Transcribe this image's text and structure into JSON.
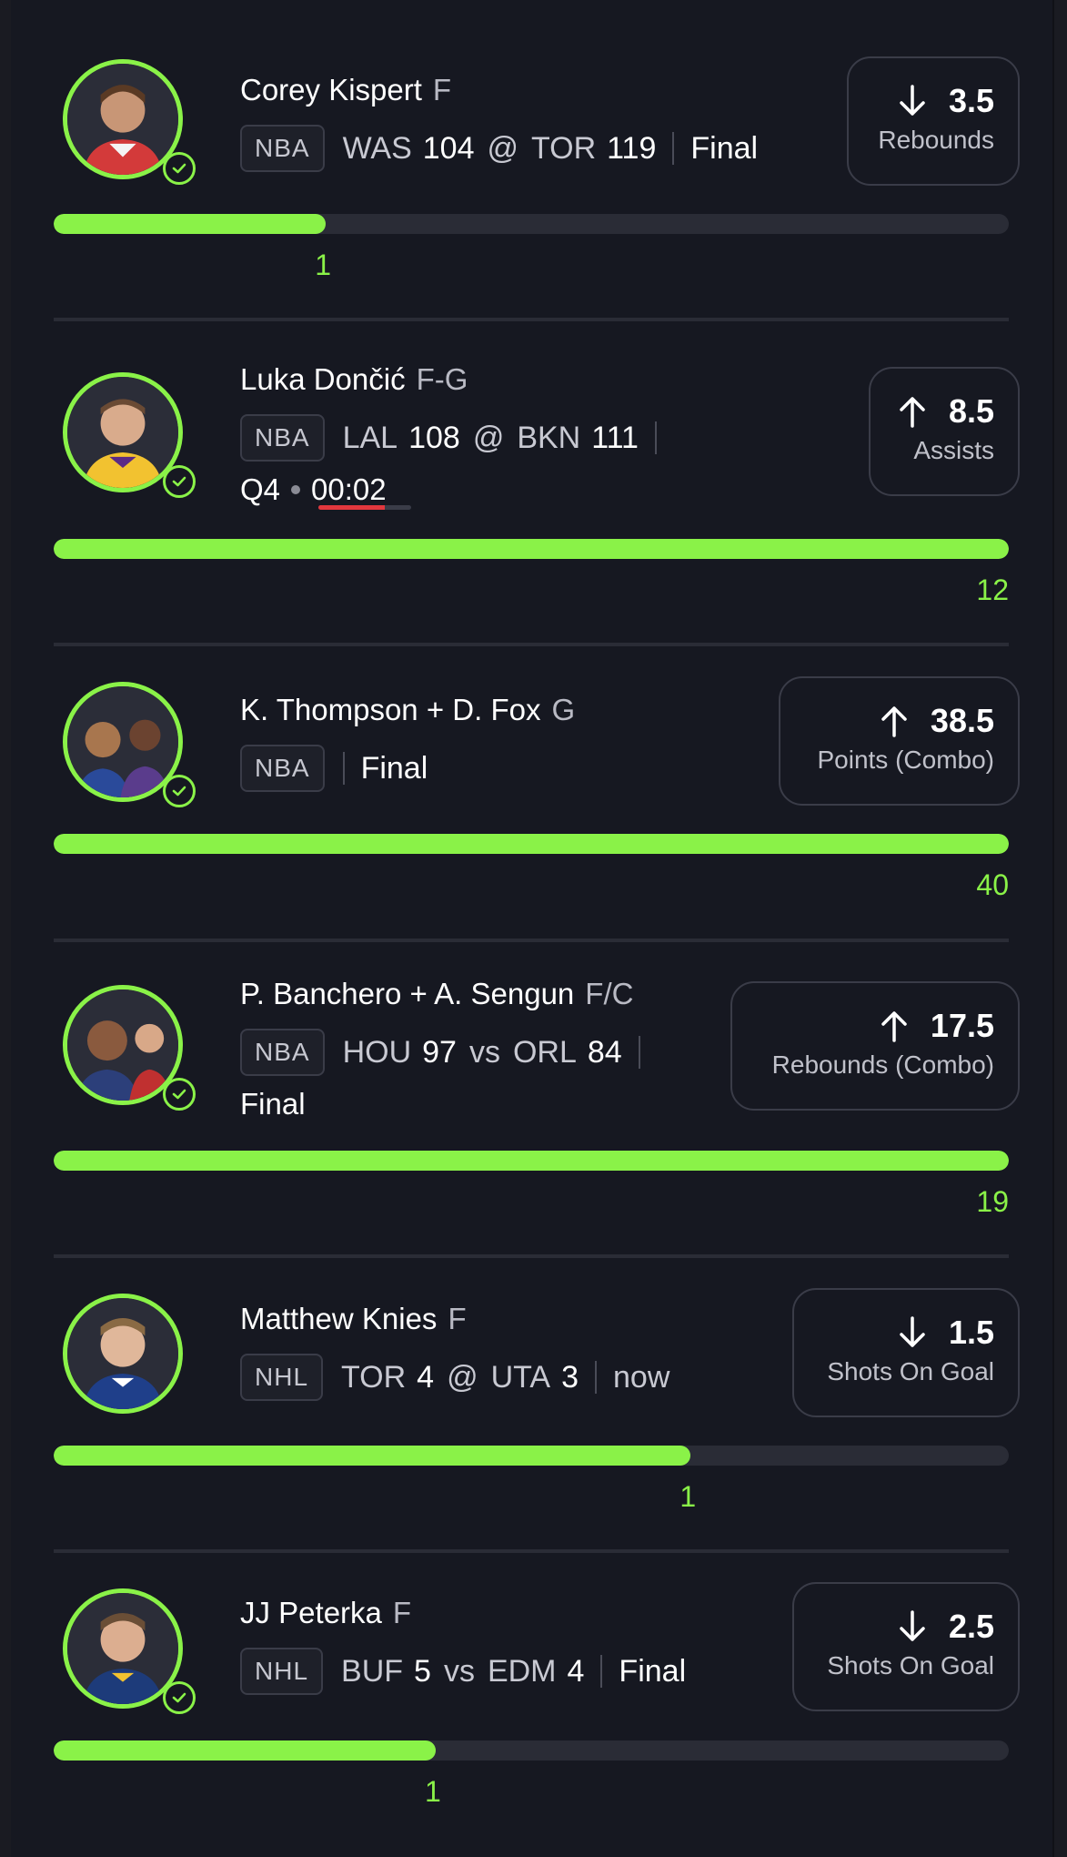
{
  "colors": {
    "accent": "#8af248",
    "background": "#161821",
    "track": "#2a2c36",
    "live_red": "#e2373d"
  },
  "picks": [
    {
      "name": "Corey Kispert",
      "position": "F",
      "league": "NBA",
      "away_team": "WAS",
      "away_score": "104",
      "separator": "@",
      "home_team": "TOR",
      "home_score": "119",
      "status": "Final",
      "direction": "down",
      "line": "3.5",
      "stat": "Rebounds",
      "actual": "1",
      "progress": 0.285,
      "avatar_icon": "player-headshot-icon",
      "checked": true
    },
    {
      "name": "Luka Dončić",
      "position": "F-G",
      "league": "NBA",
      "away_team": "LAL",
      "away_score": "108",
      "separator": "@",
      "home_team": "BKN",
      "home_score": "111",
      "period": "Q4",
      "clock": "00:02",
      "clock_progress": 0.72,
      "direction": "up",
      "line": "8.5",
      "stat": "Assists",
      "actual": "12",
      "progress": 1.0,
      "avatar_icon": "player-headshot-icon",
      "checked": true
    },
    {
      "name": "K. Thompson + D. Fox",
      "position": "G",
      "league": "NBA",
      "status": "Final",
      "direction": "up",
      "line": "38.5",
      "stat": "Points (Combo)",
      "actual": "40",
      "progress": 1.0,
      "avatar_icon": "combo-headshot-icon",
      "checked": true
    },
    {
      "name": "P. Banchero + A. Sengun",
      "position": "F/C",
      "league": "NBA",
      "away_team": "HOU",
      "away_score": "97",
      "separator": "vs",
      "home_team": "ORL",
      "home_score": "84",
      "status": "Final",
      "direction": "up",
      "line": "17.5",
      "stat": "Rebounds (Combo)",
      "actual": "19",
      "progress": 1.0,
      "avatar_icon": "combo-headshot-icon",
      "checked": true
    },
    {
      "name": "Matthew Knies",
      "position": "F",
      "league": "NHL",
      "away_team": "TOR",
      "away_score": "4",
      "separator": "@",
      "home_team": "UTA",
      "home_score": "3",
      "status": "now",
      "direction": "down",
      "line": "1.5",
      "stat": "Shots On Goal",
      "actual": "1",
      "progress": 0.667,
      "avatar_icon": "player-headshot-icon",
      "checked": false
    },
    {
      "name": "JJ Peterka",
      "position": "F",
      "league": "NHL",
      "away_team": "BUF",
      "away_score": "5",
      "separator": "vs",
      "home_team": "EDM",
      "home_score": "4",
      "status": "Final",
      "direction": "down",
      "line": "2.5",
      "stat": "Shots On Goal",
      "actual": "1",
      "progress": 0.4,
      "avatar_icon": "player-headshot-icon",
      "checked": true
    }
  ]
}
